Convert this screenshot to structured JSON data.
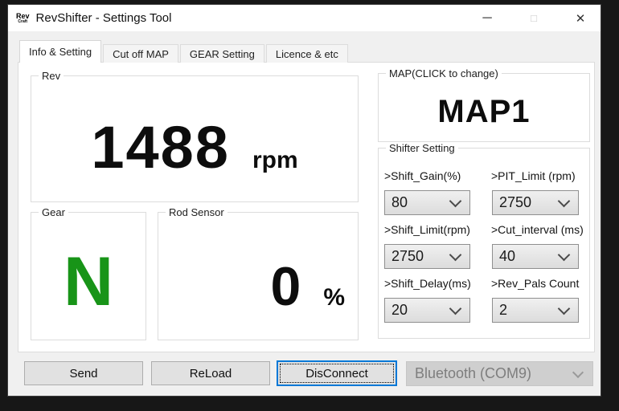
{
  "window": {
    "title": "RevShifter - Settings Tool",
    "icon_top": "Rev",
    "icon_bottom": "Craft",
    "controls": {
      "minimize": "─",
      "maximize": "□",
      "close": "✕"
    }
  },
  "tabs": [
    {
      "label": "Info & Setting",
      "active": true
    },
    {
      "label": "Cut off MAP",
      "active": false
    },
    {
      "label": "GEAR Setting",
      "active": false
    },
    {
      "label": "Licence & etc",
      "active": false
    }
  ],
  "rev": {
    "label": "Rev",
    "value": "1488",
    "unit": "rpm"
  },
  "map": {
    "label": "MAP(CLICK to change)",
    "value": "MAP1"
  },
  "gear": {
    "label": "Gear",
    "value": "N",
    "color": "#189418"
  },
  "rod_sensor": {
    "label": "Rod Sensor",
    "value": "0",
    "unit": "%"
  },
  "shifter": {
    "label": "Shifter Setting",
    "fields": [
      {
        "label": ">Shift_Gain(%)",
        "value": "80"
      },
      {
        "label": ">PIT_Limit (rpm)",
        "value": "2750"
      },
      {
        "label": ">Shift_Limit(rpm)",
        "value": "2750"
      },
      {
        "label": ">Cut_interval (ms)",
        "value": "40"
      },
      {
        "label": ">Shift_Delay(ms)",
        "value": "20"
      },
      {
        "label": ">Rev_Pals Count",
        "value": "2"
      }
    ]
  },
  "footer": {
    "send": "Send",
    "reload": "ReLoad",
    "disconnect": "DisConnect",
    "port": "Bluetooth (COM9)"
  },
  "colors": {
    "accent_focus": "#0078d7",
    "gear_green": "#189418"
  }
}
